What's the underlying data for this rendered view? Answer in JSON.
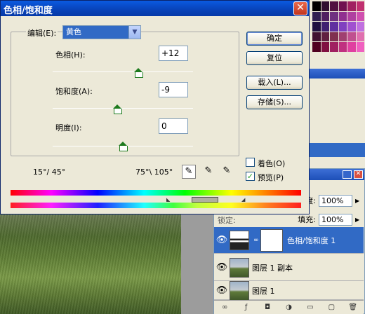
{
  "dialog": {
    "title": "色相/饱和度",
    "close_glyph": "✕",
    "edit_label": "编辑(E):",
    "edit_value": "黄色",
    "hue_label": "色相(H):",
    "hue_value": "+12",
    "saturation_label": "饱和度(A):",
    "saturation_value": "-9",
    "lightness_label": "明度(I):",
    "lightness_value": "0",
    "hue_level": 0.61,
    "saturation_level": 0.46,
    "lightness_level": 0.5,
    "range_left": "15°/ 45°",
    "range_right": "75°\\ 105°",
    "buttons": {
      "ok": "确定",
      "reset": "复位",
      "load": "载入(L)...",
      "save": "存储(S)..."
    },
    "colorize_label": "着色(O)",
    "colorize_checked": false,
    "preview_label": "预览(P)",
    "preview_checked": true,
    "preview_check_glyph": "✓"
  },
  "layers_panel": {
    "opacity_label": "度:",
    "opacity_value": "100%",
    "fill_label": "填充:",
    "fill_value": "100%",
    "lock_label": "锁定:",
    "layers": [
      {
        "name": "色相/饱和度 1",
        "selected": true,
        "type": "adjustment"
      },
      {
        "name": "图层 1 副本",
        "selected": false,
        "type": "image"
      },
      {
        "name": "图层 1",
        "selected": false,
        "type": "image"
      }
    ]
  },
  "colors": {
    "title_bar": "#0842b8",
    "selection": "#316ac5",
    "dialog_bg": "#ece9d8",
    "slider_green": "#1d7a1d"
  }
}
